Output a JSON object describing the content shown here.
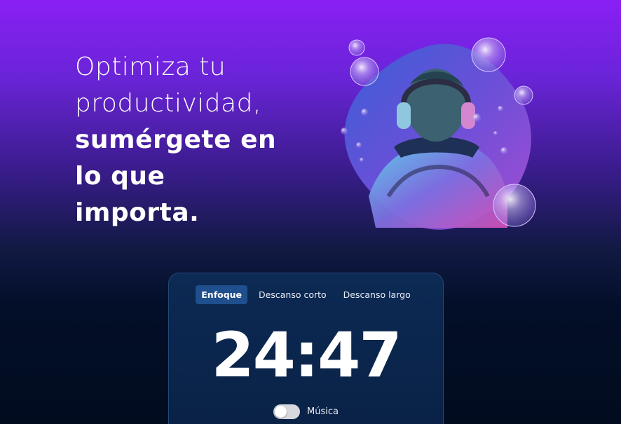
{
  "hero": {
    "line1": "Optimiza tu",
    "line2": "productividad,",
    "line3": "sumérgete en",
    "line4": "lo que",
    "line5": "importa."
  },
  "timer": {
    "tabs": [
      {
        "label": "Enfoque",
        "active": true
      },
      {
        "label": "Descanso corto",
        "active": false
      },
      {
        "label": "Descanso largo",
        "active": false
      }
    ],
    "time": "24:47",
    "music_label": "Música",
    "music_enabled": false
  },
  "colors": {
    "accent": "#1f4f8d",
    "bg_top": "#8a1ff4",
    "bg_bottom": "#020c1f"
  },
  "icons": [
    "music-toggle",
    "headphones-illustration"
  ]
}
